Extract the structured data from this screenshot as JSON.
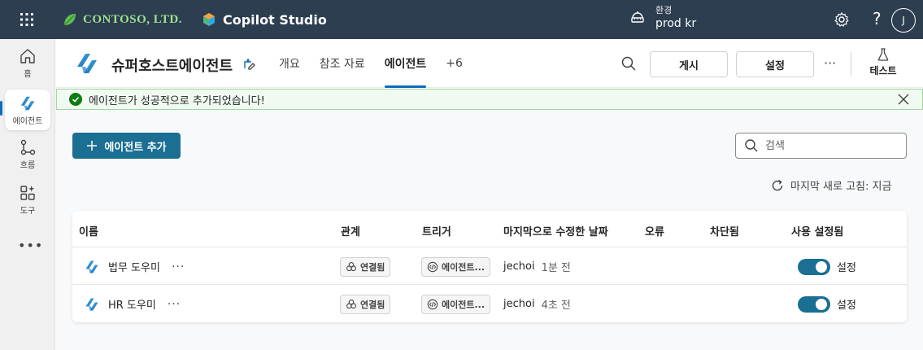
{
  "topbar": {
    "company": "CONTOSO, LTD.",
    "product": "Copilot Studio",
    "env_label": "환경",
    "env_value": "prod kr",
    "help": "?",
    "avatar_initial": "J",
    "brand_color": "#9be28f"
  },
  "rail": {
    "items": [
      {
        "label": "홈",
        "icon": "home-icon"
      },
      {
        "label": "에이전트",
        "icon": "agent-icon"
      },
      {
        "label": "흐름",
        "icon": "flow-icon"
      },
      {
        "label": "도구",
        "icon": "tools-icon"
      }
    ],
    "more": "•••"
  },
  "header": {
    "agent_title": "슈퍼호스트에이전트",
    "tabs": [
      {
        "label": "개요"
      },
      {
        "label": "참조 자료"
      },
      {
        "label": "에이전트"
      },
      {
        "label": "+6"
      }
    ],
    "active_tab": "에이전트",
    "publish_label": "게시",
    "settings_label": "설정",
    "more": "···",
    "test_label": "테스트",
    "accent": "#0f6cbd"
  },
  "banner": {
    "message": "에이전트가 성공적으로 추가되었습니다!",
    "success_color": "#107c10"
  },
  "main": {
    "add_label": "에이전트 추가",
    "search_placeholder": "검색",
    "refresh_text": "마지막 새로 고침: 지금",
    "primary_color": "#1a6f93"
  },
  "table": {
    "columns": [
      "이름",
      "관계",
      "트리거",
      "마지막으로 수정한 날짜",
      "오류",
      "차단됨",
      "사용 설정됨"
    ],
    "rows": [
      {
        "name": "법무 도우미",
        "more": "···",
        "relation": "연결됨",
        "trigger": "에이전트...",
        "modified_by": "jechoi",
        "modified_ago": "1분 전",
        "error": "",
        "blocked": "",
        "enabled": true,
        "enabled_label": "설정"
      },
      {
        "name": "HR 도우미",
        "more": "···",
        "relation": "연결됨",
        "trigger": "에이전트...",
        "modified_by": "jechoi",
        "modified_ago": "4초 전",
        "error": "",
        "blocked": "",
        "enabled": true,
        "enabled_label": "설정"
      }
    ]
  }
}
